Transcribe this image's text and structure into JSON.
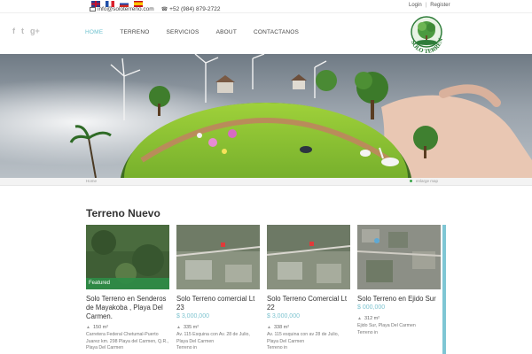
{
  "topbar": {
    "flags": [
      "flag-uk",
      "flag-fr",
      "flag-ru",
      "flag-es"
    ],
    "email": "info@soloterreno.com",
    "phone": "+52 (984) 879-2722",
    "login": "Login",
    "register": "Register"
  },
  "header": {
    "social": [
      "f",
      "t",
      "g+"
    ],
    "nav": [
      "HOME",
      "TERRENO",
      "SERVICIOS",
      "ABOUT",
      "CONTACTANOS"
    ],
    "logo_text": "SOLO TERRENO"
  },
  "breadcrumb": {
    "home": "Home",
    "enlarge": "enlarge map"
  },
  "section": {
    "title": "Terreno Nuevo"
  },
  "listings": [
    {
      "name": "Solo Terreno en Senderos de Mayakoba , Playa Del Carmen.",
      "price": "",
      "area": "150 m²",
      "address": "Carretera Federal Chetumal-Puerto Juarez km. 298 Playa del Carmen, Q.R., Playa Del Carmen",
      "type": "",
      "badge": "Featured"
    },
    {
      "name": "Solo Terreno comercial Lt 23",
      "price": "$ 3,000,000",
      "area": "335 m²",
      "address": "Av. 115 Esquina con Av. 28 de Julio, Playa Del Carmen",
      "type": "Terreno in",
      "badge": ""
    },
    {
      "name": "Solo Terreno Comercial Lt 22",
      "price": "$ 3,000,000",
      "area": "338 m²",
      "address": "Av. 115 esquina con av 28 de Julio, Playa Del Carmen",
      "type": "Terreno in",
      "badge": ""
    },
    {
      "name": "Solo Terreno en Ejido Sur",
      "price": "$ 000,000",
      "area": "312 m²",
      "address": "Ejido Sur, Playa Del Carmen",
      "type": "Terreno in",
      "badge": ""
    }
  ],
  "colors": {
    "accent": "#6ec2cf",
    "featured": "#2e8c46",
    "price": "#7fc4d0"
  }
}
